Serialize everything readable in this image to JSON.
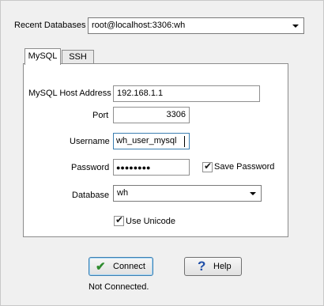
{
  "recent_databases": {
    "label": "Recent Databases",
    "selected": "root@localhost:3306:wh"
  },
  "tabs": [
    {
      "label": "MySQL"
    },
    {
      "label": "SSH"
    }
  ],
  "mysql": {
    "host_label": "MySQL Host Address",
    "host_value": "192.168.1.1",
    "port_label": "Port",
    "port_value": "3306",
    "username_label": "Username",
    "username_value": "wh_user_mysql",
    "password_label": "Password",
    "password_value": "●●●●●●●●",
    "save_password_label": "Save Password",
    "save_password_checked": true,
    "database_label": "Database",
    "database_value": "wh",
    "use_unicode_label": "Use Unicode",
    "use_unicode_checked": true
  },
  "buttons": {
    "connect_label": "Connect",
    "help_label": "Help"
  },
  "status_text": "Not Connected.",
  "icons": {
    "connect": "checkmark-icon",
    "help": "question-mark-icon",
    "dropdown": "chevron-down-icon"
  },
  "colors": {
    "check_green": "#2e8b2e",
    "help_blue": "#1f4fa8",
    "focus_border": "#3c7fb1"
  }
}
